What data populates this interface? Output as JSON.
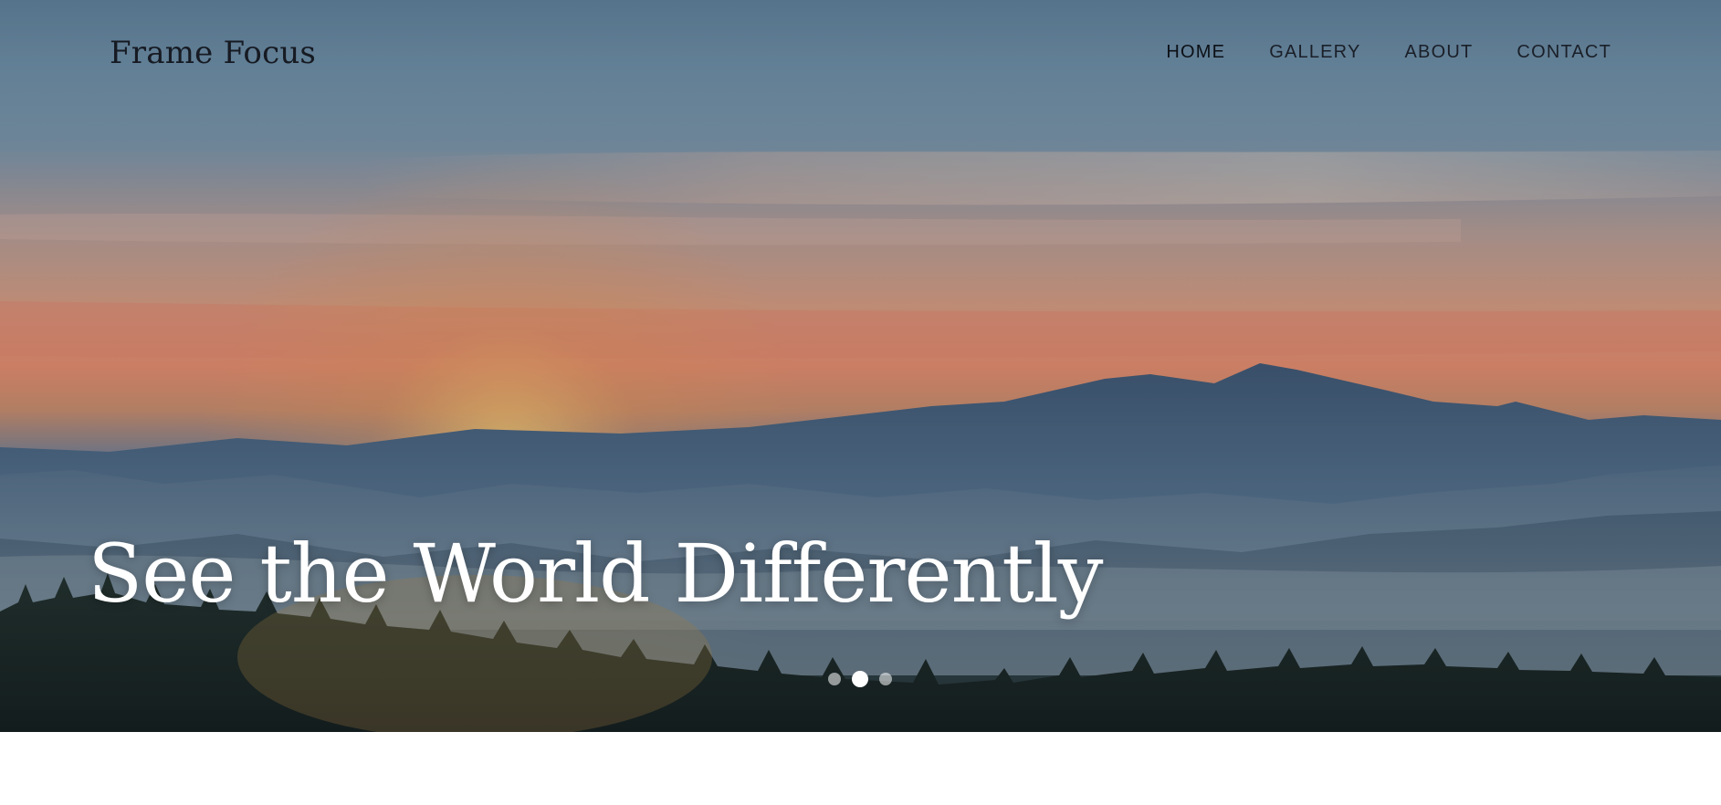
{
  "header": {
    "brand": "Frame Focus",
    "nav": [
      {
        "label": "HOME",
        "active": true
      },
      {
        "label": "GALLERY",
        "active": false
      },
      {
        "label": "ABOUT",
        "active": false
      },
      {
        "label": "CONTACT",
        "active": false
      }
    ]
  },
  "hero": {
    "headline": "See the World Differently",
    "carousel": {
      "slide_count": 3,
      "active_index": 1
    }
  },
  "colors": {
    "headline_text": "#ffffff",
    "nav_text": "#1a1f28",
    "sky_top": "#5f7f99",
    "sunset_glow": "#e58b6d",
    "mountain_shadow": "#2f4660",
    "forest": "#1d2a2c"
  }
}
